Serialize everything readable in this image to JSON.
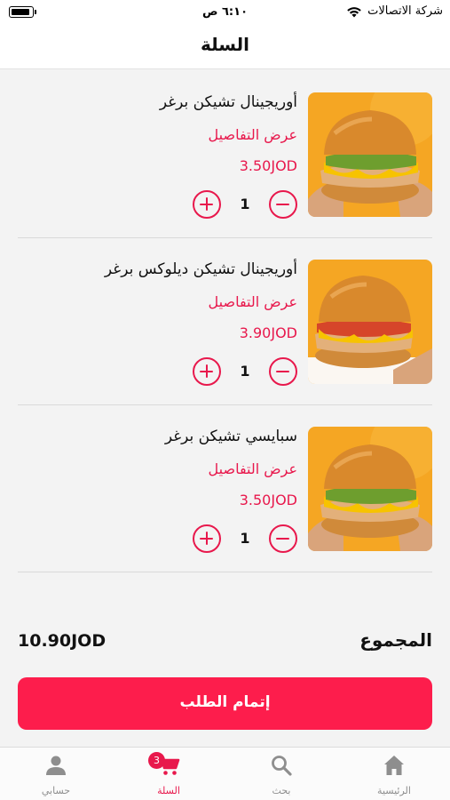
{
  "status_bar": {
    "carrier": "شركة الاتصالات",
    "time": "٦:١٠ ص"
  },
  "header": {
    "title": "السلة"
  },
  "cart": {
    "items": [
      {
        "name": "أوريجينال تشيكن برغر",
        "details_label": "عرض التفاصيل",
        "price": "3.50JOD",
        "quantity": "1",
        "image_icon": "chicken-burger-photo"
      },
      {
        "name": "أوريجينال تشيكن ديلوكس برغر",
        "details_label": "عرض التفاصيل",
        "price": "3.90JOD",
        "quantity": "1",
        "image_icon": "chicken-deluxe-burger-photo"
      },
      {
        "name": "سبايسي تشيكن برغر",
        "details_label": "عرض التفاصيل",
        "price": "3.50JOD",
        "quantity": "1",
        "image_icon": "spicy-chicken-burger-photo"
      }
    ]
  },
  "total": {
    "label": "المجموع",
    "value": "10.90JOD"
  },
  "checkout": {
    "label": "إتمام الطلب"
  },
  "tabbar": {
    "badge_count": "3",
    "tabs": [
      {
        "label": "الرئيسية",
        "icon": "home-icon"
      },
      {
        "label": "بحث",
        "icon": "search-icon"
      },
      {
        "label": "السلة",
        "icon": "cart-icon",
        "active": true
      },
      {
        "label": "حسابي",
        "icon": "person-icon"
      }
    ]
  },
  "colors": {
    "accent": "#e8184c",
    "button": "#fd1d4c",
    "background": "#f3f3f3",
    "photo_background": "#f5a623"
  }
}
